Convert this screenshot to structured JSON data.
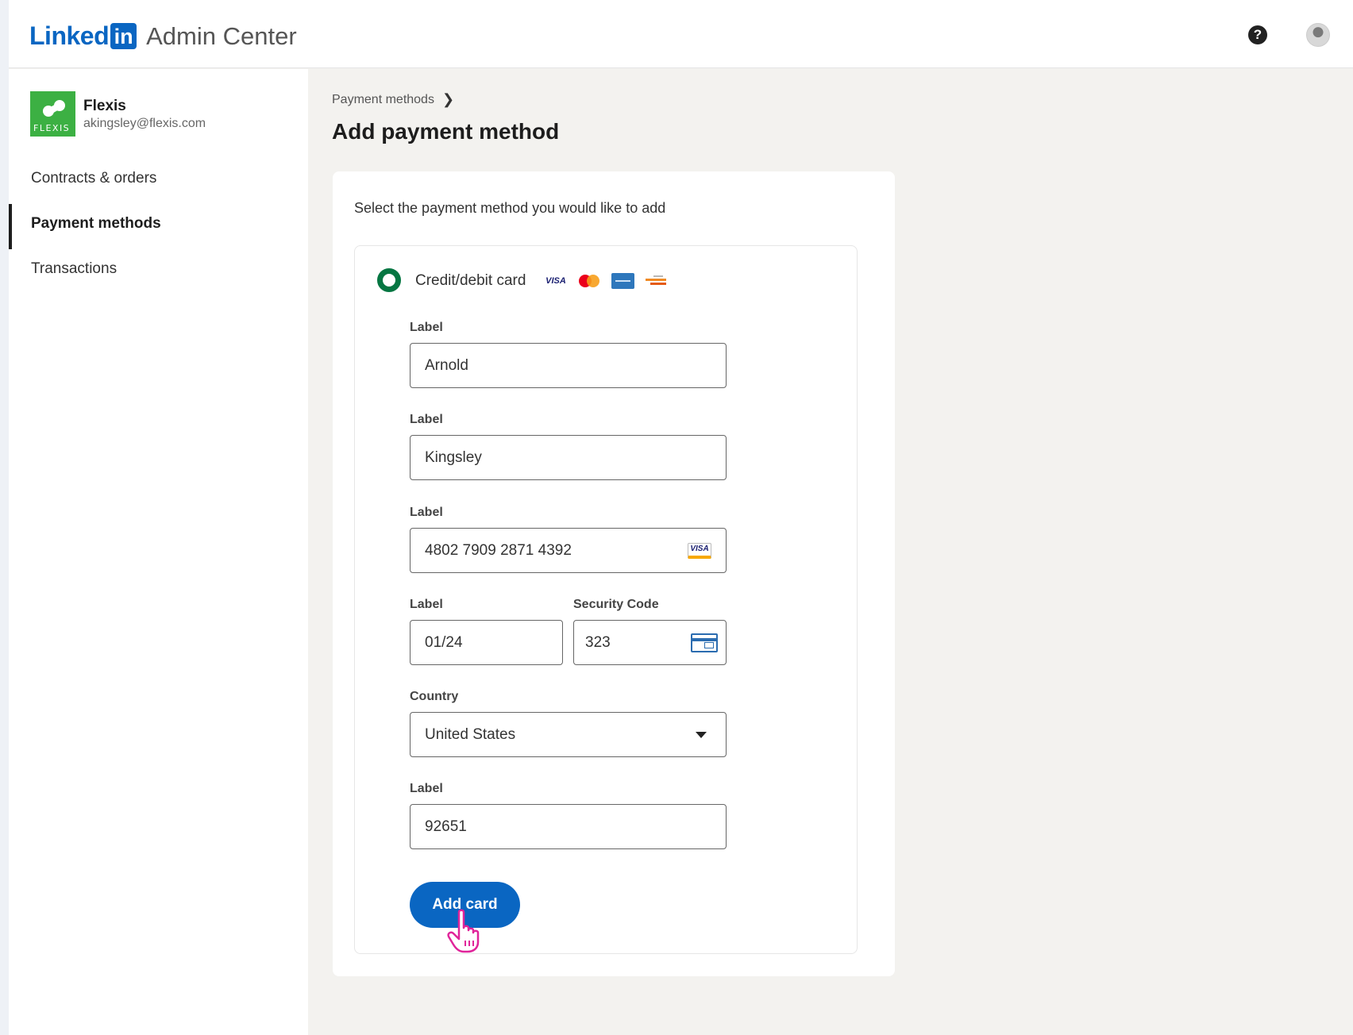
{
  "header": {
    "logo_word": "Linked",
    "logo_in": "in",
    "product": "Admin Center",
    "help_glyph": "?"
  },
  "sidebar": {
    "org_name": "Flexis",
    "org_email": "akingsley@flexis.com",
    "org_logo_text": "FLEXIS",
    "items": [
      {
        "label": "Contracts & orders"
      },
      {
        "label": "Payment methods",
        "active": true
      },
      {
        "label": "Transactions"
      }
    ]
  },
  "main": {
    "breadcrumb": "Payment methods",
    "breadcrumb_chevron": "❯",
    "title": "Add payment method",
    "intro": "Select the payment method you would like to add",
    "option_label": "Credit/debit card",
    "brands": [
      "visa-icon",
      "mastercard-icon",
      "amex-icon",
      "discover-icon"
    ],
    "brand_visa_text": "VISA",
    "fields": {
      "first_label": "Label",
      "first_value": "Arnold",
      "last_label": "Label",
      "last_value": "Kingsley",
      "card_label": "Label",
      "card_value": "4802 7909 2871 4392",
      "card_brand_text": "VISA",
      "expiry_label": "Label",
      "expiry_value": "01/24",
      "security_label": "Security Code",
      "security_value": "323",
      "country_label": "Country",
      "country_value": "United States",
      "zip_label": "Label",
      "zip_value": "92651"
    },
    "submit_label": "Add card"
  },
  "colors": {
    "brand_blue": "#0a66c2",
    "radio_green": "#057642",
    "org_green": "#3cb043",
    "cursor_pink": "#e0249a"
  }
}
